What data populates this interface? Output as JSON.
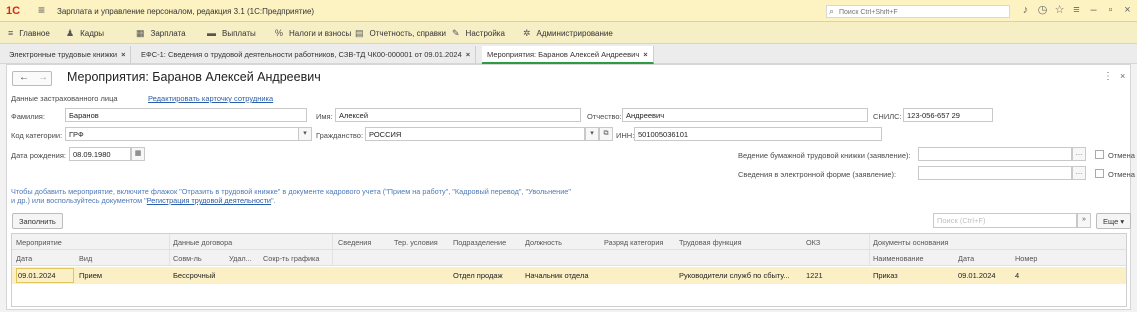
{
  "app": {
    "logo": "1С",
    "title": "Зарплата и управление персоналом, редакция 3.1 (1С:Предприятие)",
    "search_placeholder": "Поиск Ctrl+Shift+F"
  },
  "menu": [
    {
      "icon": "hamburger-icon",
      "glyph": "≡",
      "label": "Главное"
    },
    {
      "icon": "people-icon",
      "glyph": "👥",
      "label": "Кадры"
    },
    {
      "icon": "calculator-icon",
      "glyph": "▦",
      "label": "Зарплата"
    },
    {
      "icon": "wallet-icon",
      "glyph": "▬",
      "label": "Выплаты"
    },
    {
      "icon": "percent-icon",
      "glyph": "%",
      "label": "Налоги и взносы"
    },
    {
      "icon": "report-icon",
      "glyph": "▤",
      "label": "Отчетность, справки"
    },
    {
      "icon": "wrench-icon",
      "glyph": "✎",
      "label": "Настройка"
    },
    {
      "icon": "gear-icon",
      "glyph": "✲",
      "label": "Администрирование"
    }
  ],
  "tabs": [
    {
      "label": "Электронные трудовые книжки"
    },
    {
      "label": "ЕФС-1: Сведения о трудовой деятельности работников, СЗВ-ТД ЧК00-000001 от 09.01.2024"
    },
    {
      "label": "Мероприятия: Баранов Алексей Андреевич"
    }
  ],
  "form": {
    "title": "Мероприятия: Баранов Алексей Андреевич",
    "insured_label": "Данные застрахованного лица",
    "edit_link": "Редактировать карточку сотрудника",
    "surname_label": "Фамилия:",
    "surname": "Баранов",
    "name_label": "Имя:",
    "name": "Алексей",
    "patronymic_label": "Отчество:",
    "patronymic": "Андреевич",
    "snils_label": "СНИЛС:",
    "snils": "123-056-657 29",
    "category_label": "Код категории:",
    "category": "ГРФ",
    "citizenship_label": "Гражданство:",
    "citizenship": "РОССИЯ",
    "inn_label": "ИНН:",
    "inn": "501005036101",
    "birth_label": "Дата рождения:",
    "birth_date": "08.09.1980",
    "paper_book_label": "Ведение бумажной трудовой книжки (заявление):",
    "electronic_label": "Сведения в электронной форме (заявление):",
    "cancel_label": "Отмена",
    "hint_line1": "Чтобы добавить мероприятие, включите флажок \"Отразить в трудовой книжке\" в документе кадрового учета (\"Прием на работу\", \"Кадровый перевод\", \"Увольнение\"",
    "hint_line2_prefix": "и др.) или воспользуйтесь документом \"",
    "hint_link": "Регистрация трудовой деятельности",
    "hint_line2_suffix": "\".",
    "fill_button": "Заполнить",
    "table_search_placeholder": "Поиск (Ctrl+F)",
    "more_button": "Еще"
  },
  "table": {
    "header_top": [
      "Мероприятие",
      "Данные договора",
      "Сведения",
      "Тер. условия",
      "Подразделение",
      "Должность",
      "Разряд категория",
      "Трудовая функция",
      "ОКЗ",
      "Документы основания"
    ],
    "header_bottom": [
      "Дата",
      "Вид",
      "Совм-ль",
      "Удал...",
      "Сокр-ть графика",
      "Наименование",
      "Дата",
      "Номер"
    ],
    "rows": [
      {
        "date": "09.01.2024",
        "kind": "Прием",
        "contract": "Бессрочный",
        "department": "Отдел продаж",
        "position": "Начальник отдела",
        "function": "Руководители служб по сбыту...",
        "okz": "1221",
        "doc_name": "Приказ",
        "doc_date": "09.01.2024",
        "doc_number": "4"
      }
    ]
  }
}
